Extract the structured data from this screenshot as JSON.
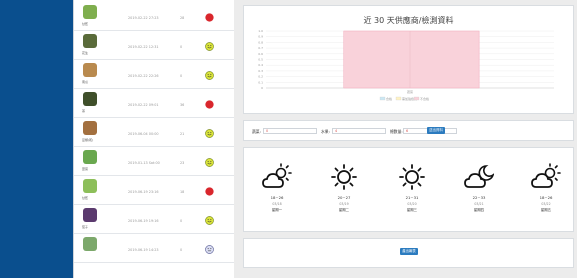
{
  "list": [
    {
      "name": "甘藍",
      "time": "2019-02-22 27:23",
      "value": "28",
      "status": "bad",
      "thumb": "#7fae4e"
    },
    {
      "name": "花生",
      "time": "2019-02-22 12:31",
      "value": "0",
      "status": "good",
      "thumb": "#5a6b3a"
    },
    {
      "name": "南瓜",
      "time": "2019-02-22 22:26",
      "value": "0",
      "status": "good",
      "thumb": "#b98a4e"
    },
    {
      "name": "茶",
      "time": "2019-02-22 09:01",
      "value": "36",
      "status": "bad",
      "thumb": "#3f4f2a"
    },
    {
      "name": "豆類(乾)",
      "time": "2019-06-04 00:00",
      "value": "21",
      "status": "good",
      "thumb": "#a3703f"
    },
    {
      "name": "葉菜",
      "time": "2019-01-13 Sat:00",
      "value": "23",
      "status": "good",
      "thumb": "#6aa84f"
    },
    {
      "name": "甘藍",
      "time": "2019-06-19 23:16",
      "value": "18",
      "status": "bad",
      "thumb": "#8dbf5a"
    },
    {
      "name": "茄子",
      "time": "2019-06-19 19:16",
      "value": "0",
      "status": "good",
      "thumb": "#5b3a6e"
    },
    {
      "name": "",
      "time": "2019-06-19 14:23",
      "value": "0",
      "status": "neutral",
      "thumb": "#7ca86b"
    }
  ],
  "chart_data": {
    "type": "bar",
    "title": "近 30 天供應商/檢測資料",
    "categories": [
      "蔬菜"
    ],
    "ylim": [
      0,
      1.0
    ],
    "yticks": [
      "1.0",
      "0.9",
      "0.8",
      "0.7",
      "0.6",
      "0.5",
      "0.4",
      "0.3",
      "0.2",
      "0.1",
      "0"
    ],
    "series": [
      {
        "name": "合格",
        "values": [
          0
        ],
        "color": "#cce8f4"
      },
      {
        "name": "需加強檢測",
        "values": [
          0
        ],
        "color": "#fff3c4"
      },
      {
        "name": "不合格",
        "values": [
          1.0
        ],
        "color": "#f9d2da"
      }
    ]
  },
  "form": {
    "label_a": "蔬菜:",
    "value_a": "0",
    "label_b": "水果:",
    "value_b": "4",
    "label_c": "總數量:",
    "value_c": "6",
    "submit_label": "送出資料"
  },
  "weather": [
    {
      "icon": "cloud-sun-icon",
      "temp": "18~26",
      "date": "03/18",
      "weekday": "星期一"
    },
    {
      "icon": "sun-icon",
      "temp": "20~27",
      "date": "03/19",
      "weekday": "星期二"
    },
    {
      "icon": "sun-icon",
      "temp": "21~31",
      "date": "03/20",
      "weekday": "星期三"
    },
    {
      "icon": "cloud-moon-icon",
      "temp": "22~33",
      "date": "03/21",
      "weekday": "星期四"
    },
    {
      "icon": "cloud-sun-icon",
      "temp": "18~26",
      "date": "03/22",
      "weekday": "星期五"
    }
  ],
  "footer": {
    "button_label": "產出報表"
  }
}
